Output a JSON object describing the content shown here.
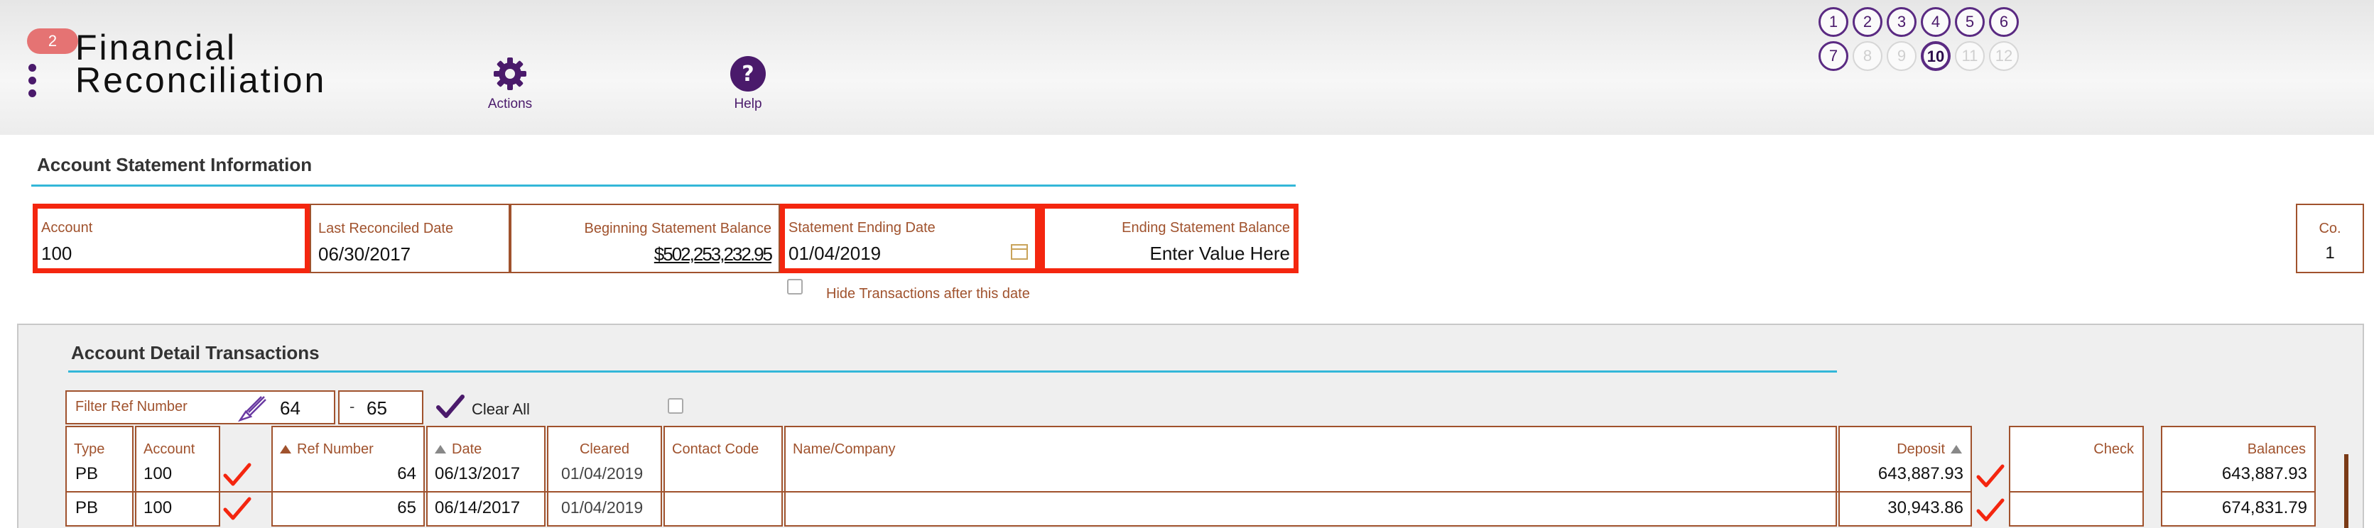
{
  "header": {
    "badge": "2",
    "title_line1": "Financial",
    "title_line2": "Reconciliation",
    "actions_label": "Actions",
    "help_label": "Help"
  },
  "steps": [
    "1",
    "2",
    "3",
    "4",
    "5",
    "6",
    "7",
    "8",
    "9",
    "10",
    "11",
    "12"
  ],
  "step_state": {
    "active": "10",
    "disabled": [
      "8",
      "9",
      "11",
      "12"
    ]
  },
  "statement": {
    "section_title": "Account Statement Information",
    "account_label": "Account",
    "account_value": "100",
    "last_reconciled_label": "Last Reconciled Date",
    "last_reconciled_value": "06/30/2017",
    "beginning_balance_label": "Beginning Statement Balance",
    "beginning_balance_value": "$502,253,232.95",
    "ending_date_label": "Statement Ending Date",
    "ending_date_value": "01/04/2019",
    "ending_balance_label": "Ending Statement Balance",
    "ending_balance_placeholder": "Enter Value Here",
    "hide_transactions_label": "Hide Transactions after this date",
    "co_label": "Co.",
    "co_value": "1"
  },
  "detail": {
    "section_title": "Account Detail Transactions",
    "filter_label": "Filter Ref Number",
    "filter_from": "64",
    "filter_to": "65",
    "clear_all_label": "Clear All",
    "columns": {
      "type": "Type",
      "account": "Account",
      "ref": "Ref Number",
      "date": "Date",
      "cleared": "Cleared",
      "contact": "Contact Code",
      "name": "Name/Company",
      "deposit": "Deposit",
      "check": "Check",
      "balances": "Balances"
    },
    "rows": [
      {
        "type": "PB",
        "account": "100",
        "ref": "64",
        "date": "06/13/2017",
        "cleared": "01/04/2019",
        "deposit": "643,887.93",
        "balance": "643,887.93"
      },
      {
        "type": "PB",
        "account": "100",
        "ref": "65",
        "date": "06/14/2017",
        "cleared": "01/04/2019",
        "deposit": "30,943.86",
        "balance": "674,831.79"
      }
    ]
  },
  "colors": {
    "accent": "#4a1a6b",
    "highlight": "#f4260f",
    "border": "#a0522d",
    "underline": "#33b7d8",
    "check": "#f4260f"
  },
  "icons": [
    "gear-icon",
    "help-icon",
    "calendar-icon",
    "brush-icon",
    "checkmark-icon",
    "sort-ascending-icon",
    "kebab-menu-icon"
  ]
}
